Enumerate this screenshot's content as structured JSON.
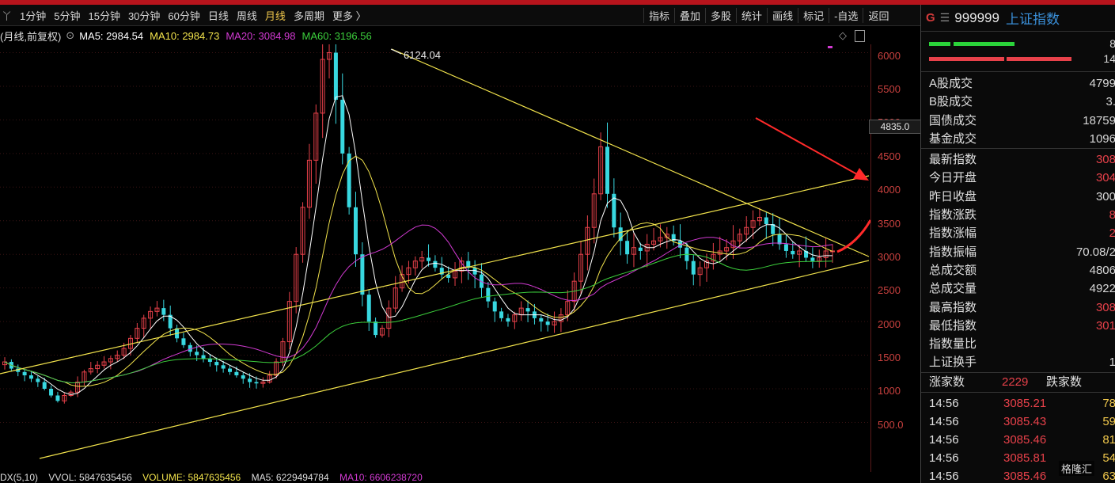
{
  "toolbar": {
    "lead": "丫",
    "periods": [
      "1分钟",
      "5分钟",
      "15分钟",
      "30分钟",
      "60分钟",
      "日线",
      "周线",
      "月线",
      "多周期",
      "更多 〉"
    ],
    "active_period": "月线",
    "tools": [
      "指标",
      "叠加",
      "多股",
      "统计",
      "画线",
      "标记",
      "-自选",
      "返回"
    ]
  },
  "legend": {
    "mode": "(月线,前复权)",
    "ma5": "MA5: 2984.54",
    "ma10": "MA10: 2984.73",
    "ma20": "MA20: 3084.98",
    "ma60": "MA60: 3196.56",
    "colors": {
      "ma5": "#ffffff",
      "ma10": "#f2e34c",
      "ma20": "#d23ad2",
      "ma60": "#3ccf3c"
    }
  },
  "chart": {
    "peak_label": "6124.04",
    "yticks": [
      "6000",
      "5500",
      "5000",
      "4500",
      "4000",
      "3500",
      "3000",
      "2500",
      "2000",
      "1500",
      "1000",
      "500.0"
    ],
    "badge": "4835.0",
    "up_color": "#e8414a",
    "down_color": "#38d8e0",
    "line_color": "#f2e34c",
    "annot_color": "#ff2a2a"
  },
  "chart_data": {
    "type": "candlestick",
    "series": [
      {
        "values": [
          1400,
          1300,
          1250,
          1200,
          1150,
          1100,
          1000,
          900,
          820,
          900,
          950,
          1100,
          1250,
          1300,
          1350,
          1400,
          1450,
          1500,
          1600,
          1750,
          1900,
          2050,
          2150,
          2200,
          2100,
          1900,
          1750,
          1650,
          1550,
          1500,
          1450,
          1400,
          1350,
          1300,
          1250,
          1200,
          1150,
          1100,
          1080,
          1100,
          1200,
          1400,
          1700,
          2300,
          3000,
          3700,
          4400,
          5100,
          5900,
          6000,
          5300,
          4500,
          3700,
          3000,
          2400,
          2000,
          1800,
          1900,
          2200,
          2500,
          2700,
          2800,
          2900,
          2950,
          2900,
          2800,
          2700,
          2650,
          2750,
          2900,
          2800,
          2700,
          2500,
          2300,
          2150,
          2050,
          2000,
          2100,
          2200,
          2150,
          2050,
          2000,
          1950,
          2000,
          2100,
          2300,
          2600,
          3000,
          3400,
          3900,
          4600,
          3900,
          3400,
          3200,
          3000,
          3100,
          3050,
          3150,
          3200,
          3250,
          3300,
          3200,
          3100,
          2900,
          2700,
          2800,
          2900,
          3000,
          3050,
          3100,
          3200,
          3300,
          3400,
          3500,
          3550,
          3450,
          3300,
          3150,
          3050,
          3000,
          3050,
          2950,
          2900,
          2950,
          3050,
          3050
        ]
      }
    ],
    "ylim": [
      500,
      6124
    ]
  },
  "bottom": {
    "indicator": "DX(5,10)",
    "vvol": "VVOL: 5847635456",
    "volume": "VOLUME: 5847635456",
    "ma5": "MA5: 6229494784",
    "ma10": "MA10: 6606238720"
  },
  "panel": {
    "mark": "G",
    "menu": "☰",
    "code": "999999",
    "name": "上证指数",
    "bar_top_val": "8",
    "bar_bot_val": "14",
    "rows_a": [
      {
        "k": "A股成交",
        "v": "4799"
      },
      {
        "k": "B股成交",
        "v": "3."
      },
      {
        "k": "国债成交",
        "v": "18759"
      },
      {
        "k": "基金成交",
        "v": "1096"
      }
    ],
    "rows_b": [
      {
        "k": "最新指数",
        "v": "308",
        "red": true
      },
      {
        "k": "今日开盘",
        "v": "304",
        "red": true
      },
      {
        "k": "昨日收盘",
        "v": "300"
      },
      {
        "k": "指数涨跌",
        "v": "8",
        "red": true
      },
      {
        "k": "指数涨幅",
        "v": "2",
        "red": true
      },
      {
        "k": "指数振幅",
        "v": "70.08/2"
      },
      {
        "k": "总成交额",
        "v": "4806"
      },
      {
        "k": "总成交量",
        "v": "4922"
      },
      {
        "k": "最高指数",
        "v": "308",
        "red": true
      },
      {
        "k": "最低指数",
        "v": "301",
        "red": true
      },
      {
        "k": "指数量比",
        "v": ""
      },
      {
        "k": "上证换手",
        "v": "1"
      }
    ],
    "up_label": "涨家数",
    "up_count": "2229",
    "down_label": "跌家数",
    "ticks": [
      {
        "t": "14:56",
        "p": "3085.21",
        "v": "78"
      },
      {
        "t": "14:56",
        "p": "3085.43",
        "v": "59"
      },
      {
        "t": "14:56",
        "p": "3085.46",
        "v": "81"
      },
      {
        "t": "14:56",
        "p": "3085.81",
        "v": "54"
      },
      {
        "t": "14:56",
        "p": "3085.46",
        "v": "63"
      }
    ],
    "watermark": "格隆汇"
  }
}
